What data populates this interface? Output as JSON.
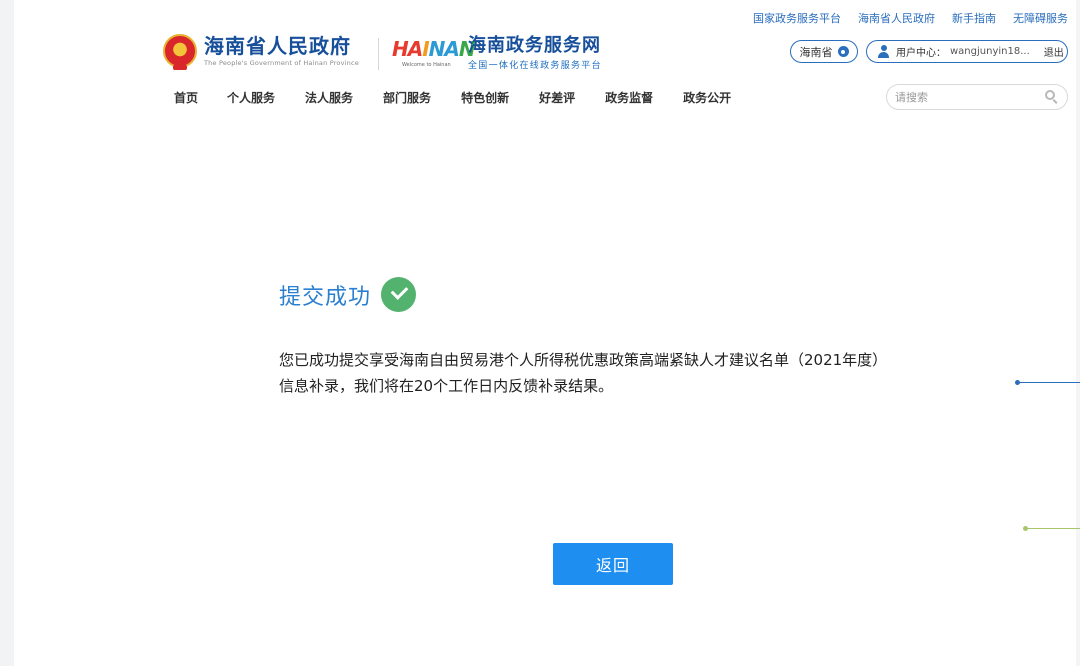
{
  "top_links": [
    {
      "label": "国家政务服务平台"
    },
    {
      "label": "海南省人民政府"
    },
    {
      "label": "新手指南"
    },
    {
      "label": "无障碍服务"
    }
  ],
  "logos": {
    "gov_title": "海南省人民政府",
    "gov_subtitle": "The People's Government of Hainan Province",
    "hainan_word": {
      "c1": "HA",
      "c2": "I",
      "c3": "NA",
      "c4": "N"
    },
    "hainan_tagline": "Welcome to Hainan",
    "service_title": "海南政务服务网",
    "service_subtitle": "全国一体化在线政务服务平台"
  },
  "header": {
    "region": "海南省",
    "user_label": "用户中心：",
    "user_name": "wangjunyin18...",
    "logout": "退出"
  },
  "nav": [
    {
      "label": "首页"
    },
    {
      "label": "个人服务"
    },
    {
      "label": "法人服务"
    },
    {
      "label": "部门服务"
    },
    {
      "label": "特色创新"
    },
    {
      "label": "好差评"
    },
    {
      "label": "政务监督"
    },
    {
      "label": "政务公开"
    }
  ],
  "search": {
    "placeholder": "请搜索",
    "value": ""
  },
  "content": {
    "success_title": "提交成功",
    "message_line1": "您已成功提交享受海南自由贸易港个人所得税优惠政策高端紧缺人才建议名单（2021年度）",
    "message_line2": "信息补录，我们将在20个工作日内反馈补录结果。",
    "back_button": "返回"
  },
  "colors": {
    "brand_blue": "#174f9a",
    "link_blue": "#2a6ebd",
    "success_green": "#53b26d",
    "button_blue": "#1e8ef0"
  }
}
